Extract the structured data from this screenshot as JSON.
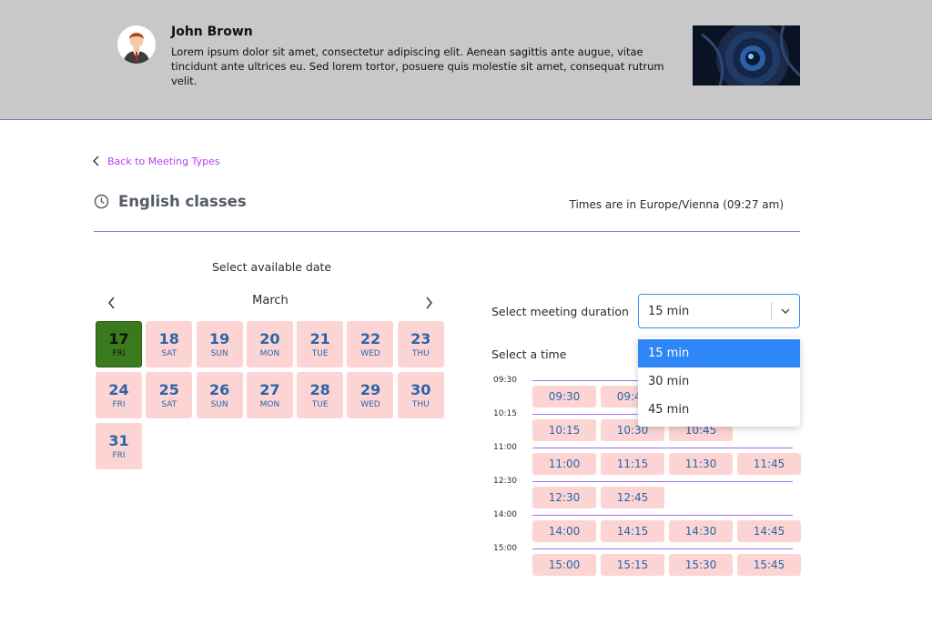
{
  "header": {
    "name": "John Brown",
    "bio": "Lorem ipsum dolor sit amet, consectetur adipiscing elit. Aenean sagittis ante augue, vitae tincidunt ante ultrices eu. Sed lorem tortor, posuere quis molestie sit amet, consequat rutrum velit."
  },
  "nav": {
    "back_label": "Back to Meeting Types"
  },
  "meeting": {
    "title": "English classes",
    "timezone": "Times are in Europe/Vienna (09:27 am)"
  },
  "calendar": {
    "heading": "Select available date",
    "month": "March",
    "days": [
      {
        "num": "17",
        "dow": "FRI",
        "selected": true
      },
      {
        "num": "18",
        "dow": "SAT"
      },
      {
        "num": "19",
        "dow": "SUN"
      },
      {
        "num": "20",
        "dow": "MON"
      },
      {
        "num": "21",
        "dow": "TUE"
      },
      {
        "num": "22",
        "dow": "WED"
      },
      {
        "num": "23",
        "dow": "THU"
      },
      {
        "num": "24",
        "dow": "FRI"
      },
      {
        "num": "25",
        "dow": "SAT"
      },
      {
        "num": "26",
        "dow": "SUN"
      },
      {
        "num": "27",
        "dow": "MON"
      },
      {
        "num": "28",
        "dow": "TUE"
      },
      {
        "num": "29",
        "dow": "WED"
      },
      {
        "num": "30",
        "dow": "THU"
      },
      {
        "num": "31",
        "dow": "FRI"
      }
    ]
  },
  "duration": {
    "label": "Select meeting duration",
    "selected": "15 min",
    "options": [
      "15 min",
      "30 min",
      "45 min"
    ]
  },
  "times": {
    "heading": "Select a time",
    "groups": [
      {
        "label": "09:30",
        "slots": [
          "09:30",
          "09:45"
        ]
      },
      {
        "label": "10:15",
        "slots": [
          "10:15",
          "10:30",
          "10:45"
        ]
      },
      {
        "label": "11:00",
        "slots": [
          "11:00",
          "11:15",
          "11:30",
          "11:45"
        ]
      },
      {
        "label": "12:30",
        "slots": [
          "12:30",
          "12:45"
        ]
      },
      {
        "label": "14:00",
        "slots": [
          "14:00",
          "14:15",
          "14:30",
          "14:45"
        ]
      },
      {
        "label": "15:00",
        "slots": [
          "15:00",
          "15:15",
          "15:30",
          "15:45"
        ]
      }
    ]
  },
  "colors": {
    "accent": "#b13ef0",
    "divider": "#a46df0",
    "slot_bg": "#fcd4d4",
    "slot_text": "#2a66a8",
    "selected_day": "#3a7a1c",
    "dropdown_active": "#2f86f6"
  }
}
